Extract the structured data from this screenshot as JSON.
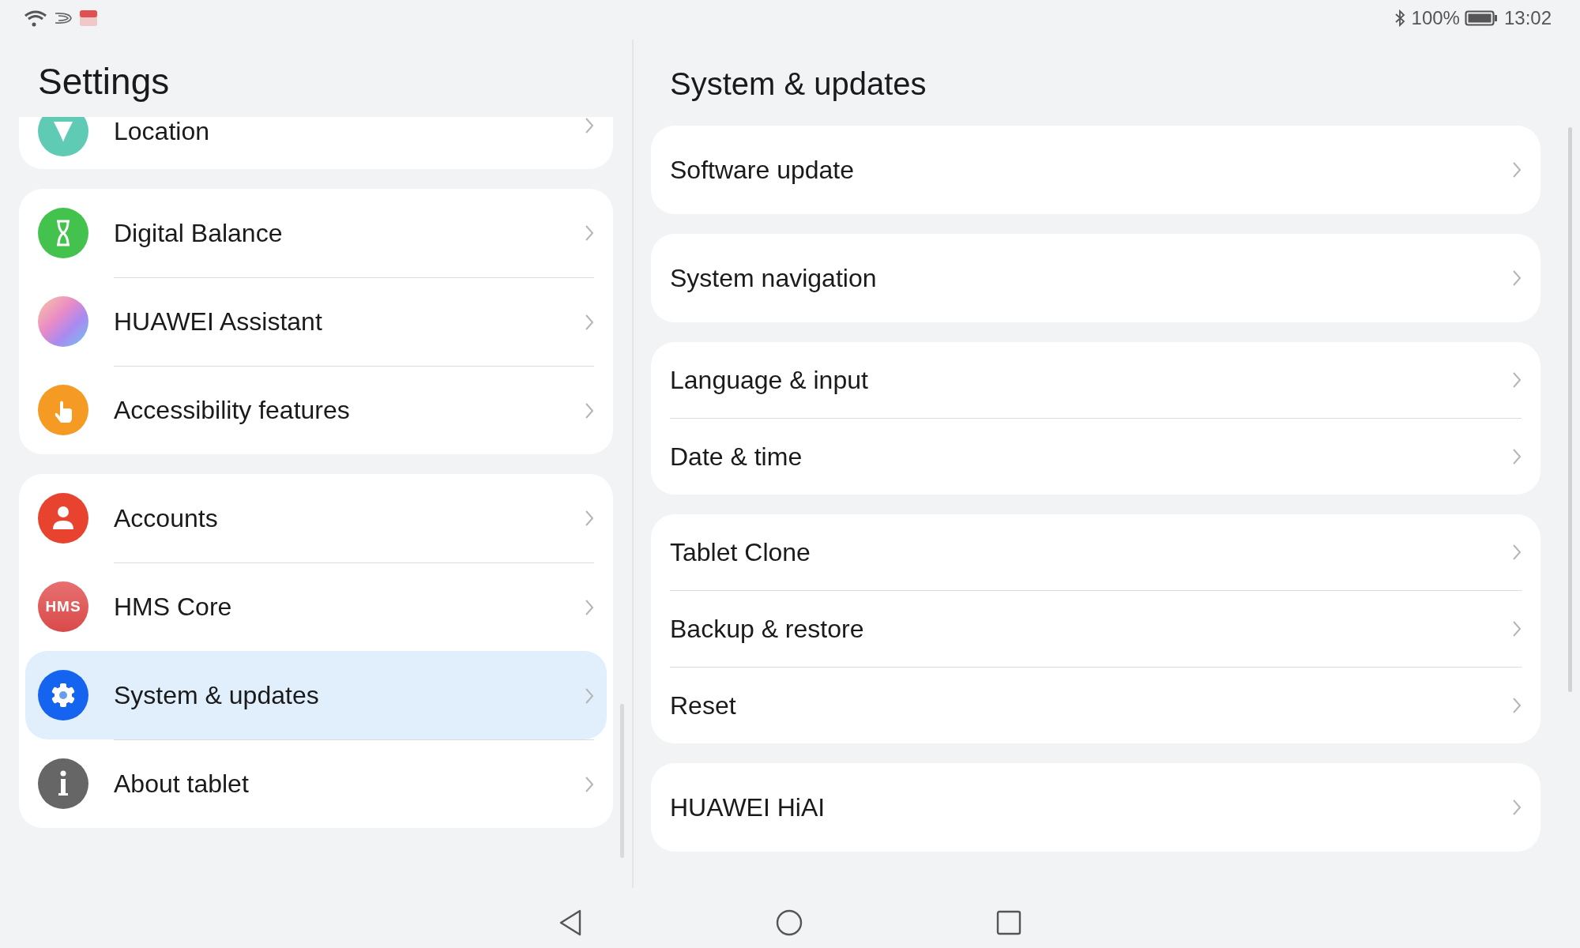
{
  "status_bar": {
    "battery": "100%",
    "time": "13:02"
  },
  "sidebar": {
    "title": "Settings",
    "groups": [
      {
        "items": [
          {
            "label": "Location",
            "kind": "location",
            "selected": false
          }
        ]
      },
      {
        "items": [
          {
            "label": "Digital Balance",
            "kind": "balance",
            "selected": false
          },
          {
            "label": "HUAWEI Assistant",
            "kind": "assistant",
            "selected": false
          },
          {
            "label": "Accessibility features",
            "kind": "accessibility",
            "selected": false
          }
        ]
      },
      {
        "items": [
          {
            "label": "Accounts",
            "kind": "account",
            "selected": false
          },
          {
            "label": "HMS Core",
            "kind": "hms",
            "icon_text": "HMS",
            "selected": false
          },
          {
            "label": "System & updates",
            "kind": "system",
            "selected": true
          },
          {
            "label": "About tablet",
            "kind": "about",
            "selected": false
          }
        ]
      }
    ]
  },
  "detail": {
    "title": "System & updates",
    "groups": [
      {
        "items": [
          "Software update"
        ]
      },
      {
        "items": [
          "System navigation"
        ]
      },
      {
        "items": [
          "Language & input",
          "Date & time"
        ]
      },
      {
        "items": [
          "Tablet Clone",
          "Backup & restore",
          "Reset"
        ]
      },
      {
        "items": [
          "HUAWEI HiAI"
        ]
      }
    ]
  }
}
